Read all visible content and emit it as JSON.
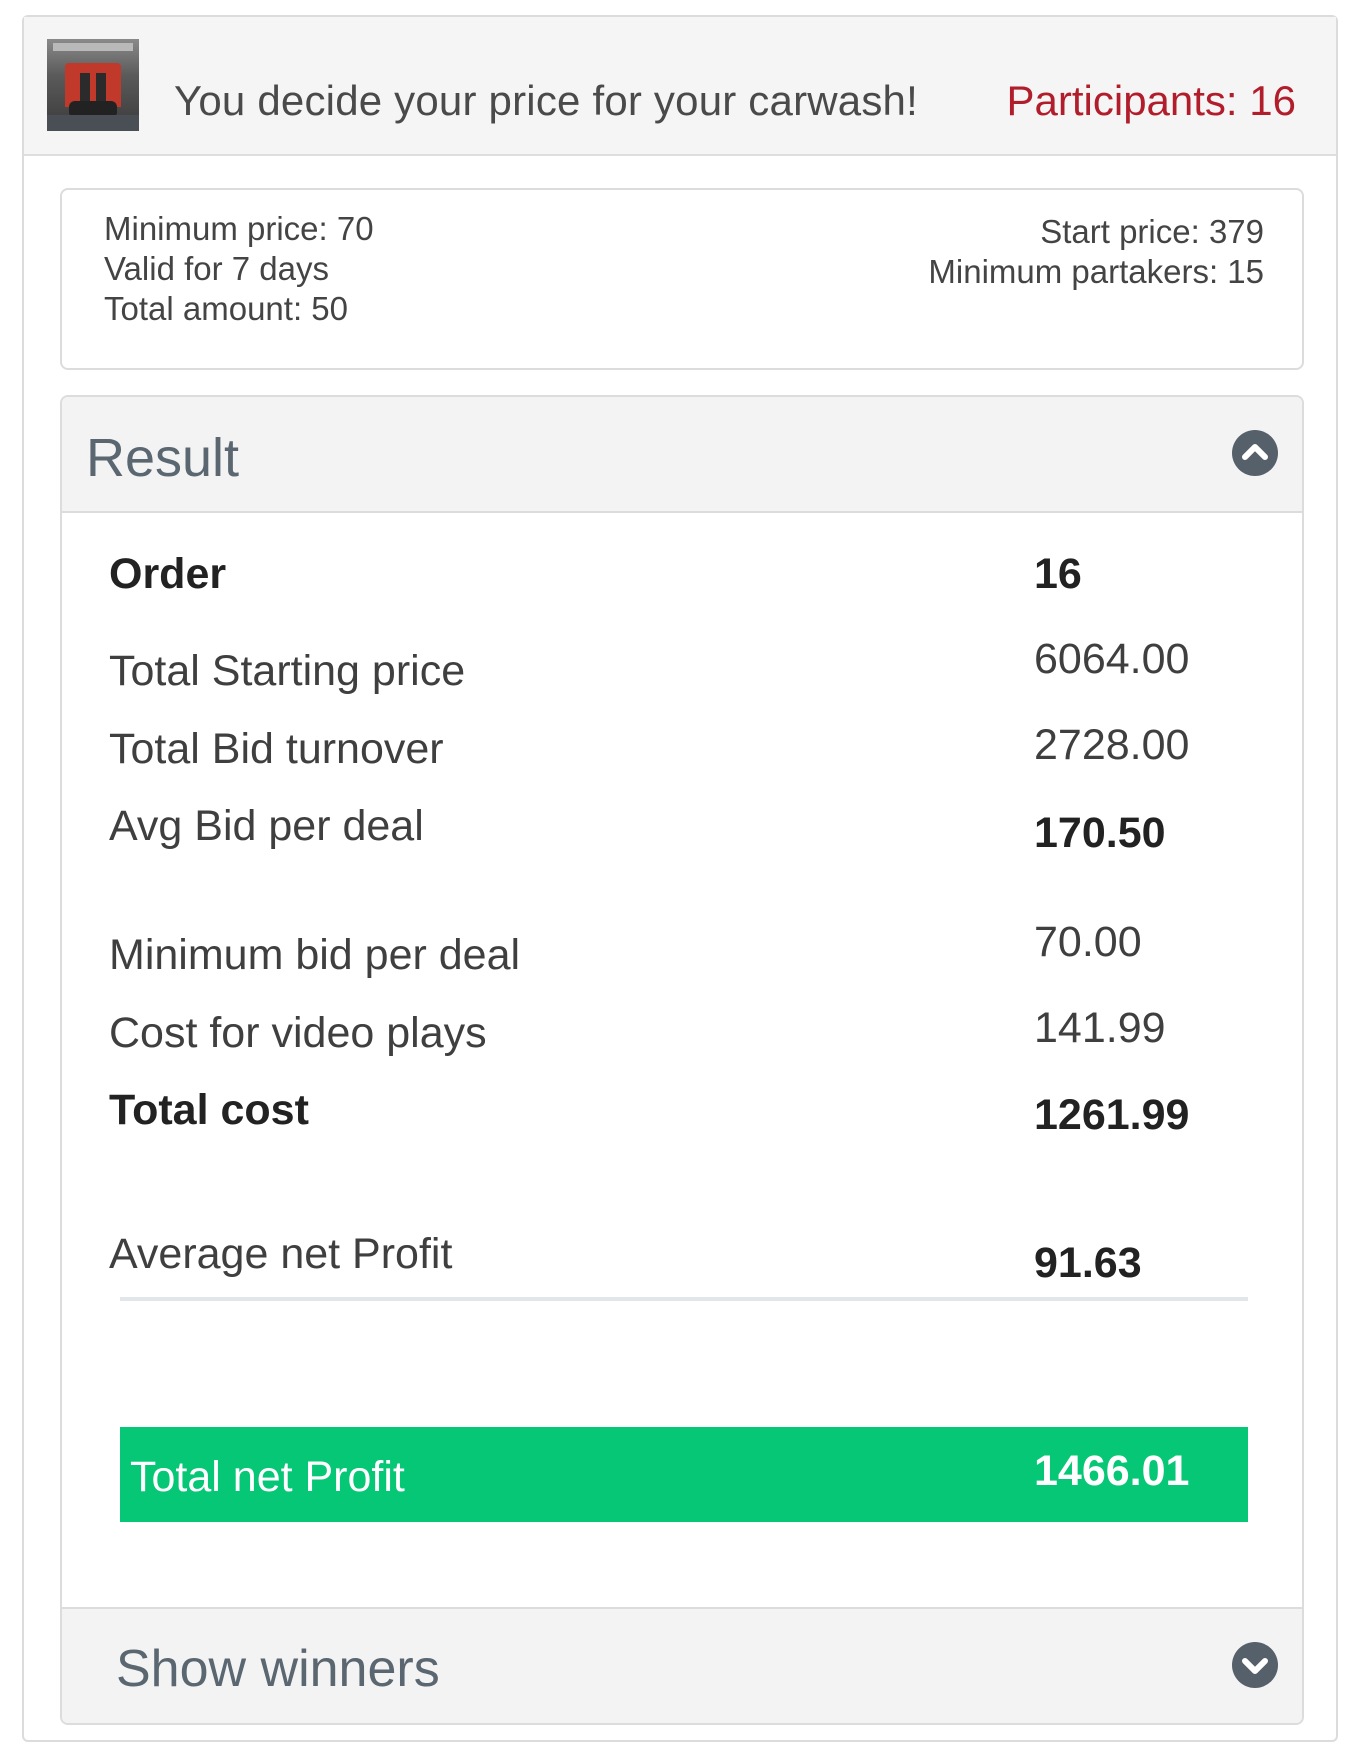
{
  "header": {
    "thumbnail_icon": "carwash-photo",
    "title": "You decide your price for your carwash!",
    "participants": "Participants: 16"
  },
  "info": {
    "minimum_price": "Minimum price: 70",
    "valid_for": "Valid for 7 days",
    "total_amount": "Total amount: 50",
    "start_price": "Start price: 379",
    "minimum_partakers": "Minimum partakers: 15"
  },
  "result": {
    "title": "Result",
    "collapse_icon": "chevron-up-icon",
    "rows": [
      {
        "label": "Order",
        "value": "16"
      },
      {
        "label": "Total Starting price",
        "value": "6064.00"
      },
      {
        "label": "Total Bid turnover",
        "value": "2728.00"
      },
      {
        "label": "Avg Bid per deal",
        "value": "170.50"
      },
      {
        "label": "Minimum bid per deal",
        "value": "70.00"
      },
      {
        "label": "Cost for video plays",
        "value": "141.99"
      },
      {
        "label": "Total cost",
        "value": "1261.99"
      },
      {
        "label": "Average net Profit",
        "value": "91.63"
      },
      {
        "label": "Total net Profit",
        "value": "1466.01"
      }
    ]
  },
  "winners": {
    "label": "Show winners",
    "expand_icon": "chevron-down-icon"
  },
  "colors": {
    "accent_red": "#b11d2b",
    "profit_green": "#05c775",
    "icon_gray": "#56606a"
  }
}
